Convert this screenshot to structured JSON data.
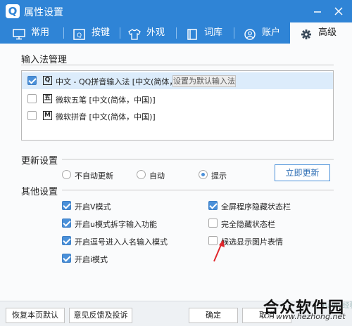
{
  "window": {
    "title": "属性设置",
    "logo": "Q",
    "min_icon": "minimize-icon",
    "close_icon": "close-icon"
  },
  "tabs": [
    {
      "label": "常用",
      "icon": "monitor-icon"
    },
    {
      "label": "按键",
      "icon": "keyboard-icon"
    },
    {
      "label": "外观",
      "icon": "shirt-icon"
    },
    {
      "label": "词库",
      "icon": "book-icon"
    },
    {
      "label": "账户",
      "icon": "user-icon"
    },
    {
      "label": "高级",
      "icon": "gear-icon",
      "active": true
    }
  ],
  "ime": {
    "heading": "输入法管理",
    "items": [
      {
        "badge": "Q",
        "label": "中文 - QQ拼音输入法 [中文(简体，...",
        "checked": true,
        "selected": true
      },
      {
        "badge": "五",
        "label": "微软五笔 [中文(简体，中国)]",
        "checked": false
      },
      {
        "badge": "M",
        "label": "微软拼音 [中文(简体，中国)]",
        "checked": false
      }
    ],
    "set_default_label": "设置为默认输入法"
  },
  "update": {
    "heading": "更新设置",
    "options": [
      {
        "label": "不自动更新",
        "selected": false
      },
      {
        "label": "自动",
        "selected": false
      },
      {
        "label": "提示",
        "selected": true
      }
    ],
    "update_now_label": "立即更新"
  },
  "other": {
    "heading": "其他设置",
    "left": [
      {
        "label": "开启V模式",
        "checked": true
      },
      {
        "label": "开启u模式拆字输入功能",
        "checked": true
      },
      {
        "label": "开启逗号进入人名输入模式",
        "checked": true
      },
      {
        "label": "开启i模式",
        "checked": true
      }
    ],
    "right": [
      {
        "label": "全屏程序隐藏状态栏",
        "checked": true
      },
      {
        "label": "完全隐藏状态栏",
        "checked": false
      },
      {
        "label": "候选显示图片表情",
        "checked": false
      }
    ]
  },
  "footer": {
    "restore_label": "恢复本页默认",
    "feedback_label": "意见反馈及投诉",
    "ok_label": "确定",
    "cancel_label": "取消"
  },
  "watermark": {
    "brand": "合众软件园",
    "url": "www.hezhong.net",
    "faint": "Baidu经验"
  },
  "colors": {
    "titlebar": "#2f84d6",
    "accent": "#4a90d9",
    "arrow": "#e0262b"
  }
}
